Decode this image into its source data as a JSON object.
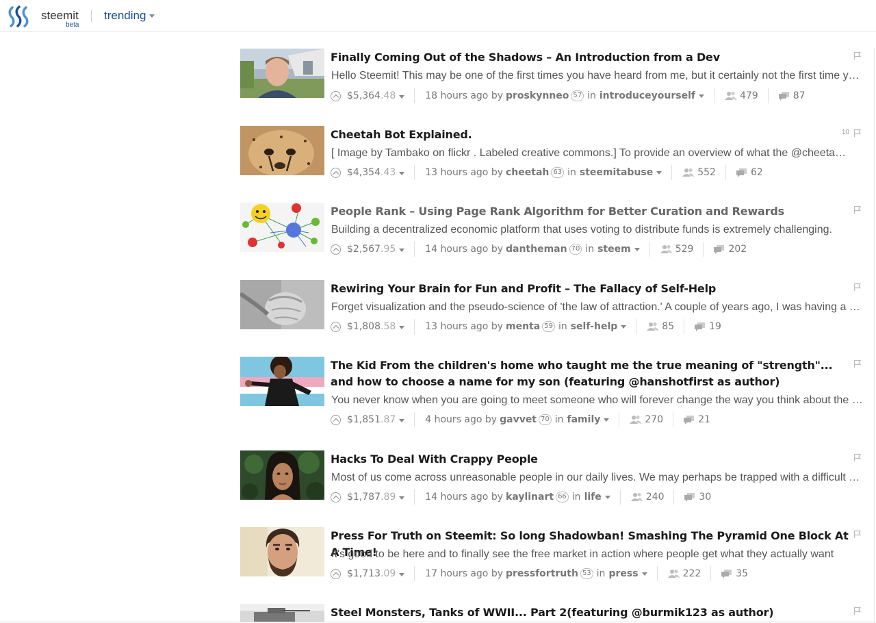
{
  "header": {
    "brand": "steemit",
    "beta": "beta",
    "sort_label": "trending"
  },
  "posts": [
    {
      "title": "Finally Coming Out of the Shadows – An Introduction from a Dev",
      "summary": "Hello Steemit! This may be one of the first times you have heard from me, but it certainly not the first time you have heard from me, I promise",
      "payout_main": "$5,364",
      "payout_cents": ".48",
      "time": "18 hours ago by",
      "author": "proskynneo",
      "reputation": "57",
      "in_word": "in",
      "category": "introduceyourself",
      "voters": "479",
      "comments": "87",
      "flag_count": ""
    },
    {
      "title": "Cheetah Bot Explained.",
      "summary": "[ Image by Tambako on flickr . Labeled creative commons.]    To provide an overview of what the @cheetah bot does and why",
      "payout_main": "$4,354",
      "payout_cents": ".43",
      "time": "13 hours ago by",
      "author": "cheetah",
      "reputation": "63",
      "in_word": "in",
      "category": "steemitabuse",
      "voters": "552",
      "comments": "62",
      "flag_count": "10"
    },
    {
      "title": "People Rank – Using Page Rank Algorithm for Better Curation and Rewards",
      "summary": "Building a decentralized economic platform that uses voting to distribute funds is extremely challenging.",
      "payout_main": "$2,567",
      "payout_cents": ".95",
      "time": "14 hours ago by",
      "author": "dantheman",
      "reputation": "70",
      "in_word": "in",
      "category": "steem",
      "voters": "529",
      "comments": "202",
      "flag_count": ""
    },
    {
      "title": "Rewiring Your Brain for Fun and Profit – The Fallacy of Self-Help",
      "summary": "Forget visualization and the pseudo-science of 'the law of attraction.' A couple of years ago, I was having a conversation with a friend",
      "payout_main": "$1,808",
      "payout_cents": ".58",
      "time": "13 hours ago by",
      "author": "menta",
      "reputation": "59",
      "in_word": "in",
      "category": "self-help",
      "voters": "85",
      "comments": "19",
      "flag_count": ""
    },
    {
      "title": "The Kid From the children's home who taught me the true meaning of \"strength\"... and how to choose a name for my son (featuring @hanshotfirst as author)",
      "summary": "You never know when you are going to meet someone who will forever change the way you think about the world",
      "payout_main": "$1,851",
      "payout_cents": ".87",
      "time": "4 hours ago by",
      "author": "gavvet",
      "reputation": "70",
      "in_word": "in",
      "category": "family",
      "voters": "270",
      "comments": "21",
      "flag_count": ""
    },
    {
      "title": "Hacks To Deal With Crappy People",
      "summary": "Most of us come across unreasonable people in our daily lives. We may perhaps be trapped with a difficult boss",
      "payout_main": "$1,787",
      "payout_cents": ".89",
      "time": "14 hours ago by",
      "author": "kaylinart",
      "reputation": "66",
      "in_word": "in",
      "category": "life",
      "voters": "240",
      "comments": "30",
      "flag_count": ""
    },
    {
      "title": "Press For Truth on Steemit: So long Shadowban! Smashing The Pyramid One Block At A Time!",
      "summary": "It's good to be here and to finally see the free market in action where people get what they actually want",
      "payout_main": "$1,713",
      "payout_cents": ".09",
      "time": "17 hours ago by",
      "author": "pressfortruth",
      "reputation": "53",
      "in_word": "in",
      "category": "press",
      "voters": "222",
      "comments": "35",
      "flag_count": ""
    },
    {
      "title": "Steel Monsters, Tanks of WWII... Part 2(featuring @burmik123 as author)",
      "summary": "",
      "payout_main": "",
      "payout_cents": "",
      "time": "",
      "author": "",
      "reputation": "",
      "in_word": "",
      "category": "",
      "voters": "",
      "comments": "",
      "flag_count": ""
    }
  ]
}
